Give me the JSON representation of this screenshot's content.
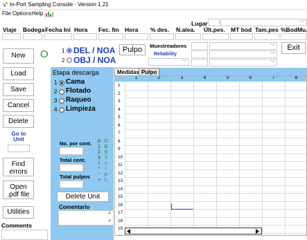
{
  "window": {
    "title": "In-Port Sampling Console - Version 1.21"
  },
  "menu": {
    "items": [
      "File",
      "Options",
      "Help"
    ]
  },
  "header": {
    "lugar_label": "Lugar",
    "columns": [
      "Viaje",
      "Bodega",
      "Fecha Ini",
      "Hora",
      "Fec. fin",
      "Hora",
      "% des.",
      "N.alea.",
      "Últ.pes.",
      "MT bod",
      "Tam.pes",
      "%BodMu."
    ]
  },
  "left_buttons": {
    "new": "New",
    "status_o": "O",
    "load": "Load",
    "save": "Save",
    "cancel": "Cancel",
    "delete": "Delete",
    "goto_unit": "Go to Unit",
    "find_errors": "Find errors",
    "open_pdf": "Open .pdf file",
    "utilities": "Utilities",
    "comments": "Comments"
  },
  "mode": {
    "opt1_num": "1",
    "opt1_label": "DEL / NOA",
    "opt2_num": "2",
    "opt2_label": "OBJ / NOA",
    "pulpo_button": "Pulpo",
    "muestreadores_label": "Muestreadores",
    "reliability_label": "Reliability",
    "exit_button": "Exit"
  },
  "etapa": {
    "title": "Etapa descarga",
    "options": [
      {
        "num": "1",
        "label": "Cama"
      },
      {
        "num": "2",
        "label": "Flotado"
      },
      {
        "num": "3",
        "label": "Raqueo"
      },
      {
        "num": "4",
        "label": "Limpieza"
      }
    ]
  },
  "counts": {
    "no_por_cont": "No. por cont.",
    "total_cont": "Total cont.",
    "total_pulpos": "Total pulpos",
    "keys_col1": [
      "0",
      "1",
      "2",
      "3",
      "/",
      "*",
      "-",
      "+"
    ],
    "keys_col2": [
      "O",
      "B",
      "S",
      "Y",
      "c",
      "r",
      "p",
      "L"
    ],
    "delete_unit": "Delete Unit",
    "comentario": "Comentario"
  },
  "grid": {
    "tabs": [
      "Medidas",
      "Pulpo"
    ],
    "columns": [
      "1",
      "2",
      "3",
      "4",
      "5",
      "6",
      "7",
      "8"
    ],
    "rows": [
      "1",
      "2",
      "3",
      "4",
      "5",
      "6",
      "7",
      "8",
      "9",
      "10",
      "11",
      "12",
      "13",
      "14",
      "15",
      "16",
      "17",
      "18",
      "19",
      "20"
    ]
  },
  "colors": {
    "panel_blue": "#8fc8f0",
    "green_o": "#1a8f2a",
    "link_blue": "#1a3cc9"
  }
}
